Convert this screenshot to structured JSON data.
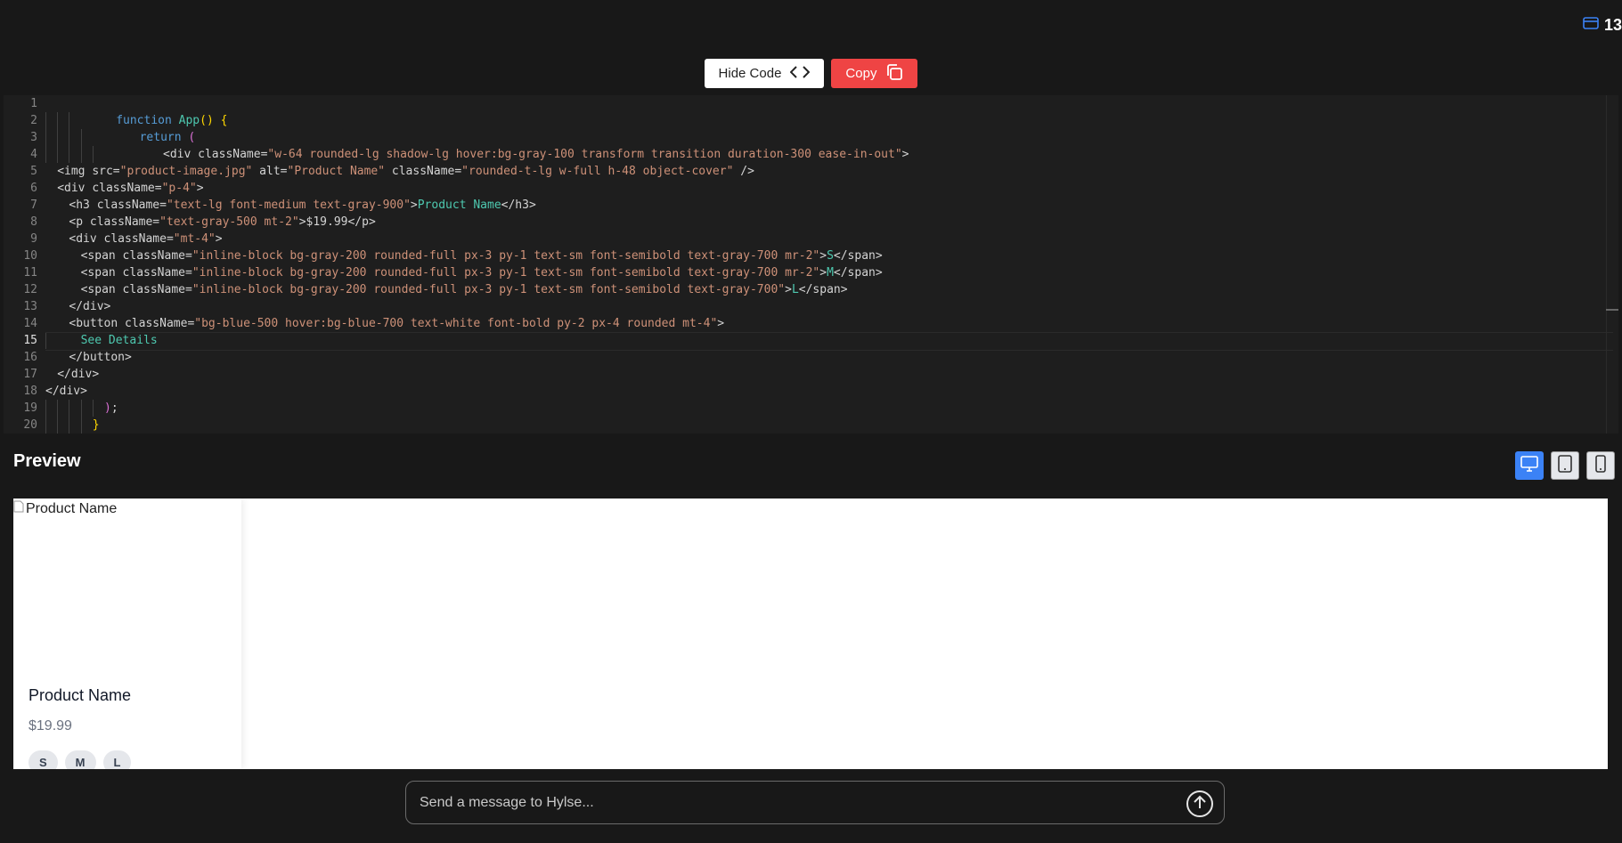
{
  "header": {
    "counter": "13"
  },
  "toolbar": {
    "hide_code_label": "Hide Code",
    "copy_label": "Copy"
  },
  "editor": {
    "lines": [
      {
        "n": "1",
        "indent": 0,
        "guides": 0,
        "tokens": []
      },
      {
        "n": "2",
        "indent": 6,
        "guides": 3,
        "tokens": [
          [
            "kw",
            "function"
          ],
          [
            "pl",
            " "
          ],
          [
            "fn",
            "App"
          ],
          [
            "br",
            "()"
          ],
          [
            "pl",
            " "
          ],
          [
            "br",
            "{"
          ]
        ]
      },
      {
        "n": "3",
        "indent": 8,
        "guides": 4,
        "tokens": [
          [
            "kw",
            "return"
          ],
          [
            "pl",
            " "
          ],
          [
            "pa",
            "("
          ]
        ]
      },
      {
        "n": "4",
        "indent": 10,
        "guides": 5,
        "tokens": [
          [
            "pl",
            "<div "
          ],
          [
            "pl",
            "className="
          ],
          [
            "st",
            "\"w-64 rounded-lg shadow-lg hover:bg-gray-100 transform transition duration-300 ease-in-out\""
          ],
          [
            "pl",
            ">"
          ]
        ]
      },
      {
        "n": "5",
        "indent": 1,
        "guides": 0,
        "tokens": [
          [
            "pl",
            "<img src="
          ],
          [
            "st",
            "\"product-image.jpg\""
          ],
          [
            "pl",
            " alt="
          ],
          [
            "st",
            "\"Product Name\""
          ],
          [
            "pl",
            " className="
          ],
          [
            "st",
            "\"rounded-t-lg w-full h-48 object-cover\""
          ],
          [
            "pl",
            " />"
          ]
        ]
      },
      {
        "n": "6",
        "indent": 1,
        "guides": 0,
        "tokens": [
          [
            "pl",
            "<div className="
          ],
          [
            "st",
            "\"p-4\""
          ],
          [
            "pl",
            ">"
          ]
        ]
      },
      {
        "n": "7",
        "indent": 2,
        "guides": 0,
        "tokens": [
          [
            "pl",
            "<h3 className="
          ],
          [
            "st",
            "\"text-lg font-medium text-gray-900\""
          ],
          [
            "pl",
            ">"
          ],
          [
            "tx",
            "Product Name"
          ],
          [
            "pl",
            "</h3>"
          ]
        ]
      },
      {
        "n": "8",
        "indent": 2,
        "guides": 0,
        "tokens": [
          [
            "pl",
            "<p className="
          ],
          [
            "st",
            "\"text-gray-500 mt-2\""
          ],
          [
            "pl",
            ">"
          ],
          [
            "tx2",
            "$19.99"
          ],
          [
            "pl",
            "</p>"
          ]
        ]
      },
      {
        "n": "9",
        "indent": 2,
        "guides": 0,
        "tokens": [
          [
            "pl",
            "<div className="
          ],
          [
            "st",
            "\"mt-4\""
          ],
          [
            "pl",
            ">"
          ]
        ]
      },
      {
        "n": "10",
        "indent": 3,
        "guides": 0,
        "tokens": [
          [
            "pl",
            "<span className="
          ],
          [
            "st",
            "\"inline-block bg-gray-200 rounded-full px-3 py-1 text-sm font-semibold text-gray-700 mr-2\""
          ],
          [
            "pl",
            ">"
          ],
          [
            "tx",
            "S"
          ],
          [
            "pl",
            "</span>"
          ]
        ]
      },
      {
        "n": "11",
        "indent": 3,
        "guides": 0,
        "tokens": [
          [
            "pl",
            "<span className="
          ],
          [
            "st",
            "\"inline-block bg-gray-200 rounded-full px-3 py-1 text-sm font-semibold text-gray-700 mr-2\""
          ],
          [
            "pl",
            ">"
          ],
          [
            "tx",
            "M"
          ],
          [
            "pl",
            "</span>"
          ]
        ]
      },
      {
        "n": "12",
        "indent": 3,
        "guides": 0,
        "tokens": [
          [
            "pl",
            "<span className="
          ],
          [
            "st",
            "\"inline-block bg-gray-200 rounded-full px-3 py-1 text-sm font-semibold text-gray-700\""
          ],
          [
            "pl",
            ">"
          ],
          [
            "tx",
            "L"
          ],
          [
            "pl",
            "</span>"
          ]
        ]
      },
      {
        "n": "13",
        "indent": 2,
        "guides": 0,
        "tokens": [
          [
            "pl",
            "</div>"
          ]
        ]
      },
      {
        "n": "14",
        "indent": 2,
        "guides": 0,
        "tokens": [
          [
            "pl",
            "<button className="
          ],
          [
            "st",
            "\"bg-blue-500 hover:bg-blue-700 text-white font-bold py-2 px-4 rounded mt-4\""
          ],
          [
            "pl",
            ">"
          ]
        ]
      },
      {
        "n": "15",
        "indent": 3,
        "guides": 1,
        "tokens": [
          [
            "tx",
            "See Details"
          ]
        ]
      },
      {
        "n": "16",
        "indent": 2,
        "guides": 0,
        "tokens": [
          [
            "pl",
            "</button>"
          ]
        ]
      },
      {
        "n": "17",
        "indent": 1,
        "guides": 0,
        "tokens": [
          [
            "pl",
            "</div>"
          ]
        ]
      },
      {
        "n": "18",
        "indent": 0,
        "guides": 0,
        "tokens": [
          [
            "pl",
            "</div>"
          ]
        ]
      },
      {
        "n": "19",
        "indent": 5,
        "guides": 5,
        "tokens": [
          [
            "pa",
            ")"
          ],
          [
            "pl",
            ";"
          ]
        ]
      },
      {
        "n": "20",
        "indent": 4,
        "guides": 4,
        "tokens": [
          [
            "br",
            "}"
          ]
        ]
      }
    ],
    "active_line": "15"
  },
  "colors": {
    "kw": "#569cd6",
    "fn": "#4ec9b0",
    "br": "#ffd700",
    "pa": "#da70d6",
    "st": "#ce9178",
    "pl": "#d4d4d4",
    "tx": "#4ec9b0",
    "tx2": "#d4d4d4",
    "accent_blue": "#3b82f6",
    "copy_red": "#ef4444"
  },
  "preview": {
    "title": "Preview",
    "card": {
      "image_alt": "Product Name",
      "title": "Product Name",
      "price": "$19.99",
      "sizes": [
        "S",
        "M",
        "L"
      ]
    }
  },
  "chat": {
    "placeholder": "Send a message to Hylse..."
  }
}
